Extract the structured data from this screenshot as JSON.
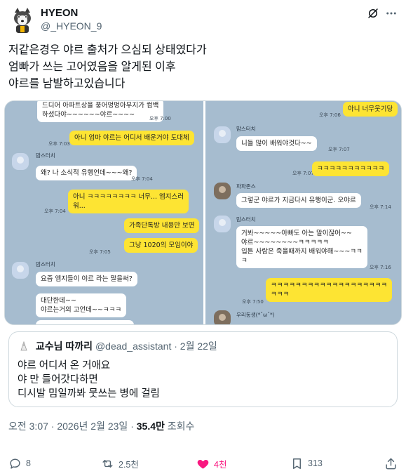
{
  "author": {
    "display_name": "HYEON",
    "handle": "@_HYEON_9",
    "avatar_icon": "husky-avatar-icon"
  },
  "post_lines": [
    "저같은경우 야르 출처가 으심되 상태였다가",
    "엄빠가 쓰는 고어였음을 알게된 이후",
    "야르를 남발하고있습니다"
  ],
  "media": {
    "left": {
      "bubbles": [
        {
          "who": "other",
          "text": "드디어 아파트상을 풍어멍멍아무지가 컴백\n하셨다야~~~~~~야르~~~~"
        },
        {
          "who": "me",
          "text": "아니 엄마 야르는 어디서 배운거야 도대체"
        },
        {
          "who": "other",
          "text": "왜? 나 소식적 유행언데~~~왜?"
        },
        {
          "who": "me",
          "text": "아니 ㅋㅋㅋㅋㅋㅋㅋㅋ 너무... 엠지스러\n워..."
        },
        {
          "who": "me",
          "text": "가족단톡방 내용만 보면"
        },
        {
          "who": "me",
          "text": "그냥 1020의 모임이야"
        },
        {
          "who": "other",
          "text": "요즘 엠지들이 야르 라는 말을써?"
        },
        {
          "who": "other",
          "text": "대단한데~~\n야르는거의 고언데~~ㅋㅋㅋ"
        }
      ],
      "senders": [
        "맘스터치",
        "맘스터치"
      ],
      "times": [
        "오후 7:00",
        "오후 7:03",
        "오후 7:04",
        "오후 7:04",
        "오후 7:05"
      ]
    },
    "right": {
      "bubbles": [
        {
          "who": "me",
          "text": "아니 너무웃기당"
        },
        {
          "who": "other",
          "text": "니들 많이 배워야것다~~"
        },
        {
          "who": "me",
          "text": "ㅋㅋㅋㅋㅋㅋㅋㅋㅋㅋㅋ"
        },
        {
          "who": "other",
          "text": "그렇군 야르가 지금다시 유행이군. 오야르"
        },
        {
          "who": "other",
          "text": "거봐~~~~~아빠도 아는 말이잖어~~\n야르~~~~~~~~ㅋㅋㅋㅋㅋ\n입튼 사람은 죽을때까지 배워야해~~~ㅋㅋ\nㅋ"
        },
        {
          "who": "me",
          "text": "ㅋㅋㅋㅋㅋㅋㅋㅋㅋㅋㅋㅋㅋㅋㅋㅋㅋㅋㅋ\nㅋㅋㅋ"
        }
      ],
      "senders": [
        "맘스터치",
        "파파존스",
        "맘스터치",
        "우리동생(*ˇωˇ*)"
      ],
      "times": [
        "오후 7:06",
        "오후 7:07",
        "오후 7:07",
        "오후 7:14",
        "오후 7:16",
        "오후 7:50"
      ]
    }
  },
  "quote": {
    "name": "교수님 따까리",
    "handle": "@dead_assistant",
    "date": "2월 22일",
    "lines": [
      "야르 어디서 온 거애요",
      "야 만 들어갓다하면",
      "디시발 밈일까봐 뭇쓰는 병에 걸림"
    ]
  },
  "meta": {
    "time": "오전 3:07",
    "sep": "·",
    "date": "2026년 2월 23일",
    "views": "35.4만",
    "views_label": "조회수"
  },
  "actions": {
    "replies": "8",
    "reposts": "2.5천",
    "likes": "4천",
    "bookmarks": "313"
  },
  "colors": {
    "like": "#f91880",
    "secondary_text": "#536471",
    "chat_background": "#a6bccf",
    "my_bubble": "#fde433"
  }
}
